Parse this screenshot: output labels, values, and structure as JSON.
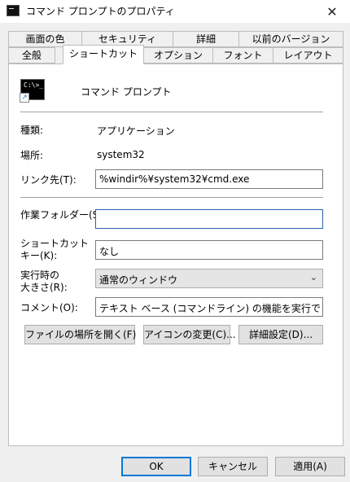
{
  "window": {
    "title": "コマンド プロンプトのプロパティ",
    "close_glyph": "✕"
  },
  "tabs_top": [
    "画面の色",
    "セキュリティ",
    "詳細",
    "以前のバージョン"
  ],
  "tabs_bottom": [
    "全般",
    "ショートカット",
    "オプション",
    "フォント",
    "レイアウト"
  ],
  "active_tab": "ショートカット",
  "header": {
    "app_name": "コマンド プロンプト",
    "icon_prompt": "C:\\>_"
  },
  "fields": {
    "type_label": "種類:",
    "type_value": "アプリケーション",
    "location_label": "場所:",
    "location_value": "system32",
    "target_label": "リンク先(T):",
    "target_value": "%windir%¥system32¥cmd.exe",
    "start_in_label": "作業フォルダー(S):",
    "start_in_value": "",
    "hotkey_label_1": "ショートカット",
    "hotkey_label_2": "キー(K):",
    "hotkey_value": "なし",
    "run_label_1": "実行時の",
    "run_label_2": "大きさ(R):",
    "run_value": "通常のウィンドウ",
    "comment_label": "コメント(O):",
    "comment_value": "テキスト ベース (コマンドライン) の機能を実行できます。"
  },
  "actions": {
    "open_location": "ファイルの場所を開く(F)",
    "change_icon": "アイコンの変更(C)...",
    "advanced": "詳細設定(D)..."
  },
  "footer": {
    "ok": "OK",
    "cancel": "キャンセル",
    "apply": "適用(A)"
  }
}
